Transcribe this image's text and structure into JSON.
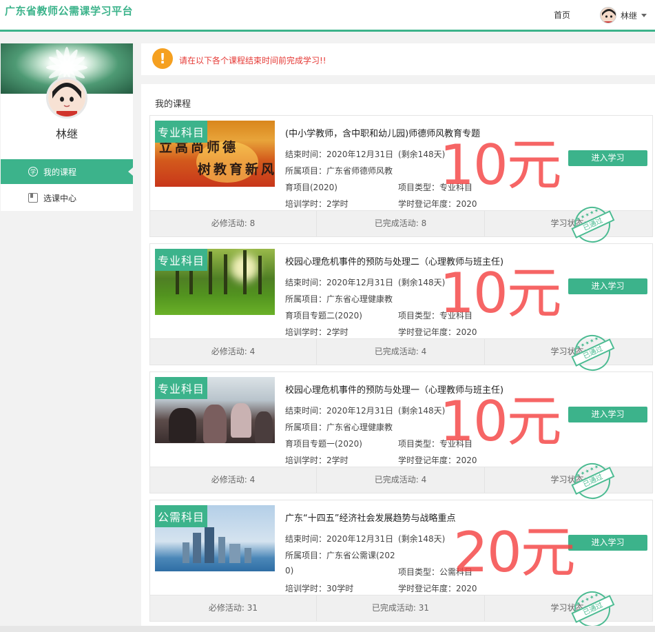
{
  "header": {
    "brand": "广东省教师公需课学习平台",
    "home": "首页",
    "user_name": "林继"
  },
  "sidebar": {
    "name": "林继",
    "items": [
      {
        "label": "我的课程",
        "icon": "study-icon"
      },
      {
        "label": "选课中心",
        "icon": "book-icon"
      }
    ]
  },
  "notice": {
    "text": "请在以下各个课程结束时间前完成学习!!"
  },
  "main": {
    "title": "我的课程",
    "courses": [
      {
        "tag": "专业科目",
        "thumb_text": [
          "立高尚师德",
          "树教育新风"
        ],
        "title": "(中小学教师，含中职和幼儿园)师德师风教育专题",
        "end": "结束时间：2020年12月31日",
        "remain": "(剩余148天)",
        "project_line1": "所属项目：广东省师德师风教",
        "project_line2": "育项目(2020)",
        "type": "项目类型：专业科目",
        "hours": "培训学时：2学时",
        "year": "学时登记年度：2020",
        "button": "进入学习",
        "required": "必修活动: 8",
        "completed": "已完成活动: 8",
        "status_label": "学习状态:",
        "stamp": "已通过",
        "price": "10元"
      },
      {
        "tag": "专业科目",
        "title": "校园心理危机事件的预防与处理二（心理教师与班主任)",
        "end": "结束时间：2020年12月31日",
        "remain": "(剩余148天)",
        "project_line1": "所属项目：广东省心理健康教",
        "project_line2": "育项目专题二(2020)",
        "type": "项目类型：专业科目",
        "hours": "培训学时：2学时",
        "year": "学时登记年度：2020",
        "button": "进入学习",
        "required": "必修活动: 4",
        "completed": "已完成活动: 4",
        "status_label": "学习状态:",
        "stamp": "已通过",
        "price": "10元"
      },
      {
        "tag": "专业科目",
        "title": "校园心理危机事件的预防与处理一（心理教师与班主任)",
        "end": "结束时间：2020年12月31日",
        "remain": "(剩余148天)",
        "project_line1": "所属项目：广东省心理健康教",
        "project_line2": "育项目专题一(2020)",
        "type": "项目类型：专业科目",
        "hours": "培训学时：2学时",
        "year": "学时登记年度：2020",
        "button": "进入学习",
        "required": "必修活动: 4",
        "completed": "已完成活动: 4",
        "status_label": "学习状态:",
        "stamp": "已通过",
        "price": "10元"
      },
      {
        "tag": "公需科目",
        "title": "广东“十四五”经济社会发展趋势与战略重点",
        "end": "结束时间：2020年12月31日",
        "remain": "(剩余148天)",
        "project_line1": "所属项目：广东省公需课(202",
        "project_line2": "0)",
        "type": "项目类型：公需科目",
        "hours": "培训学时：30学时",
        "year": "学时登记年度：2020",
        "button": "进入学习",
        "required": "必修活动: 31",
        "completed": "已完成活动: 31",
        "status_label": "学习状态:",
        "stamp": "已通过",
        "price": "20元"
      }
    ]
  },
  "colors": {
    "accent": "#3cb38b",
    "warning": "#f5a020",
    "notice_text": "#e53935",
    "price_overlay": "#f44343"
  }
}
